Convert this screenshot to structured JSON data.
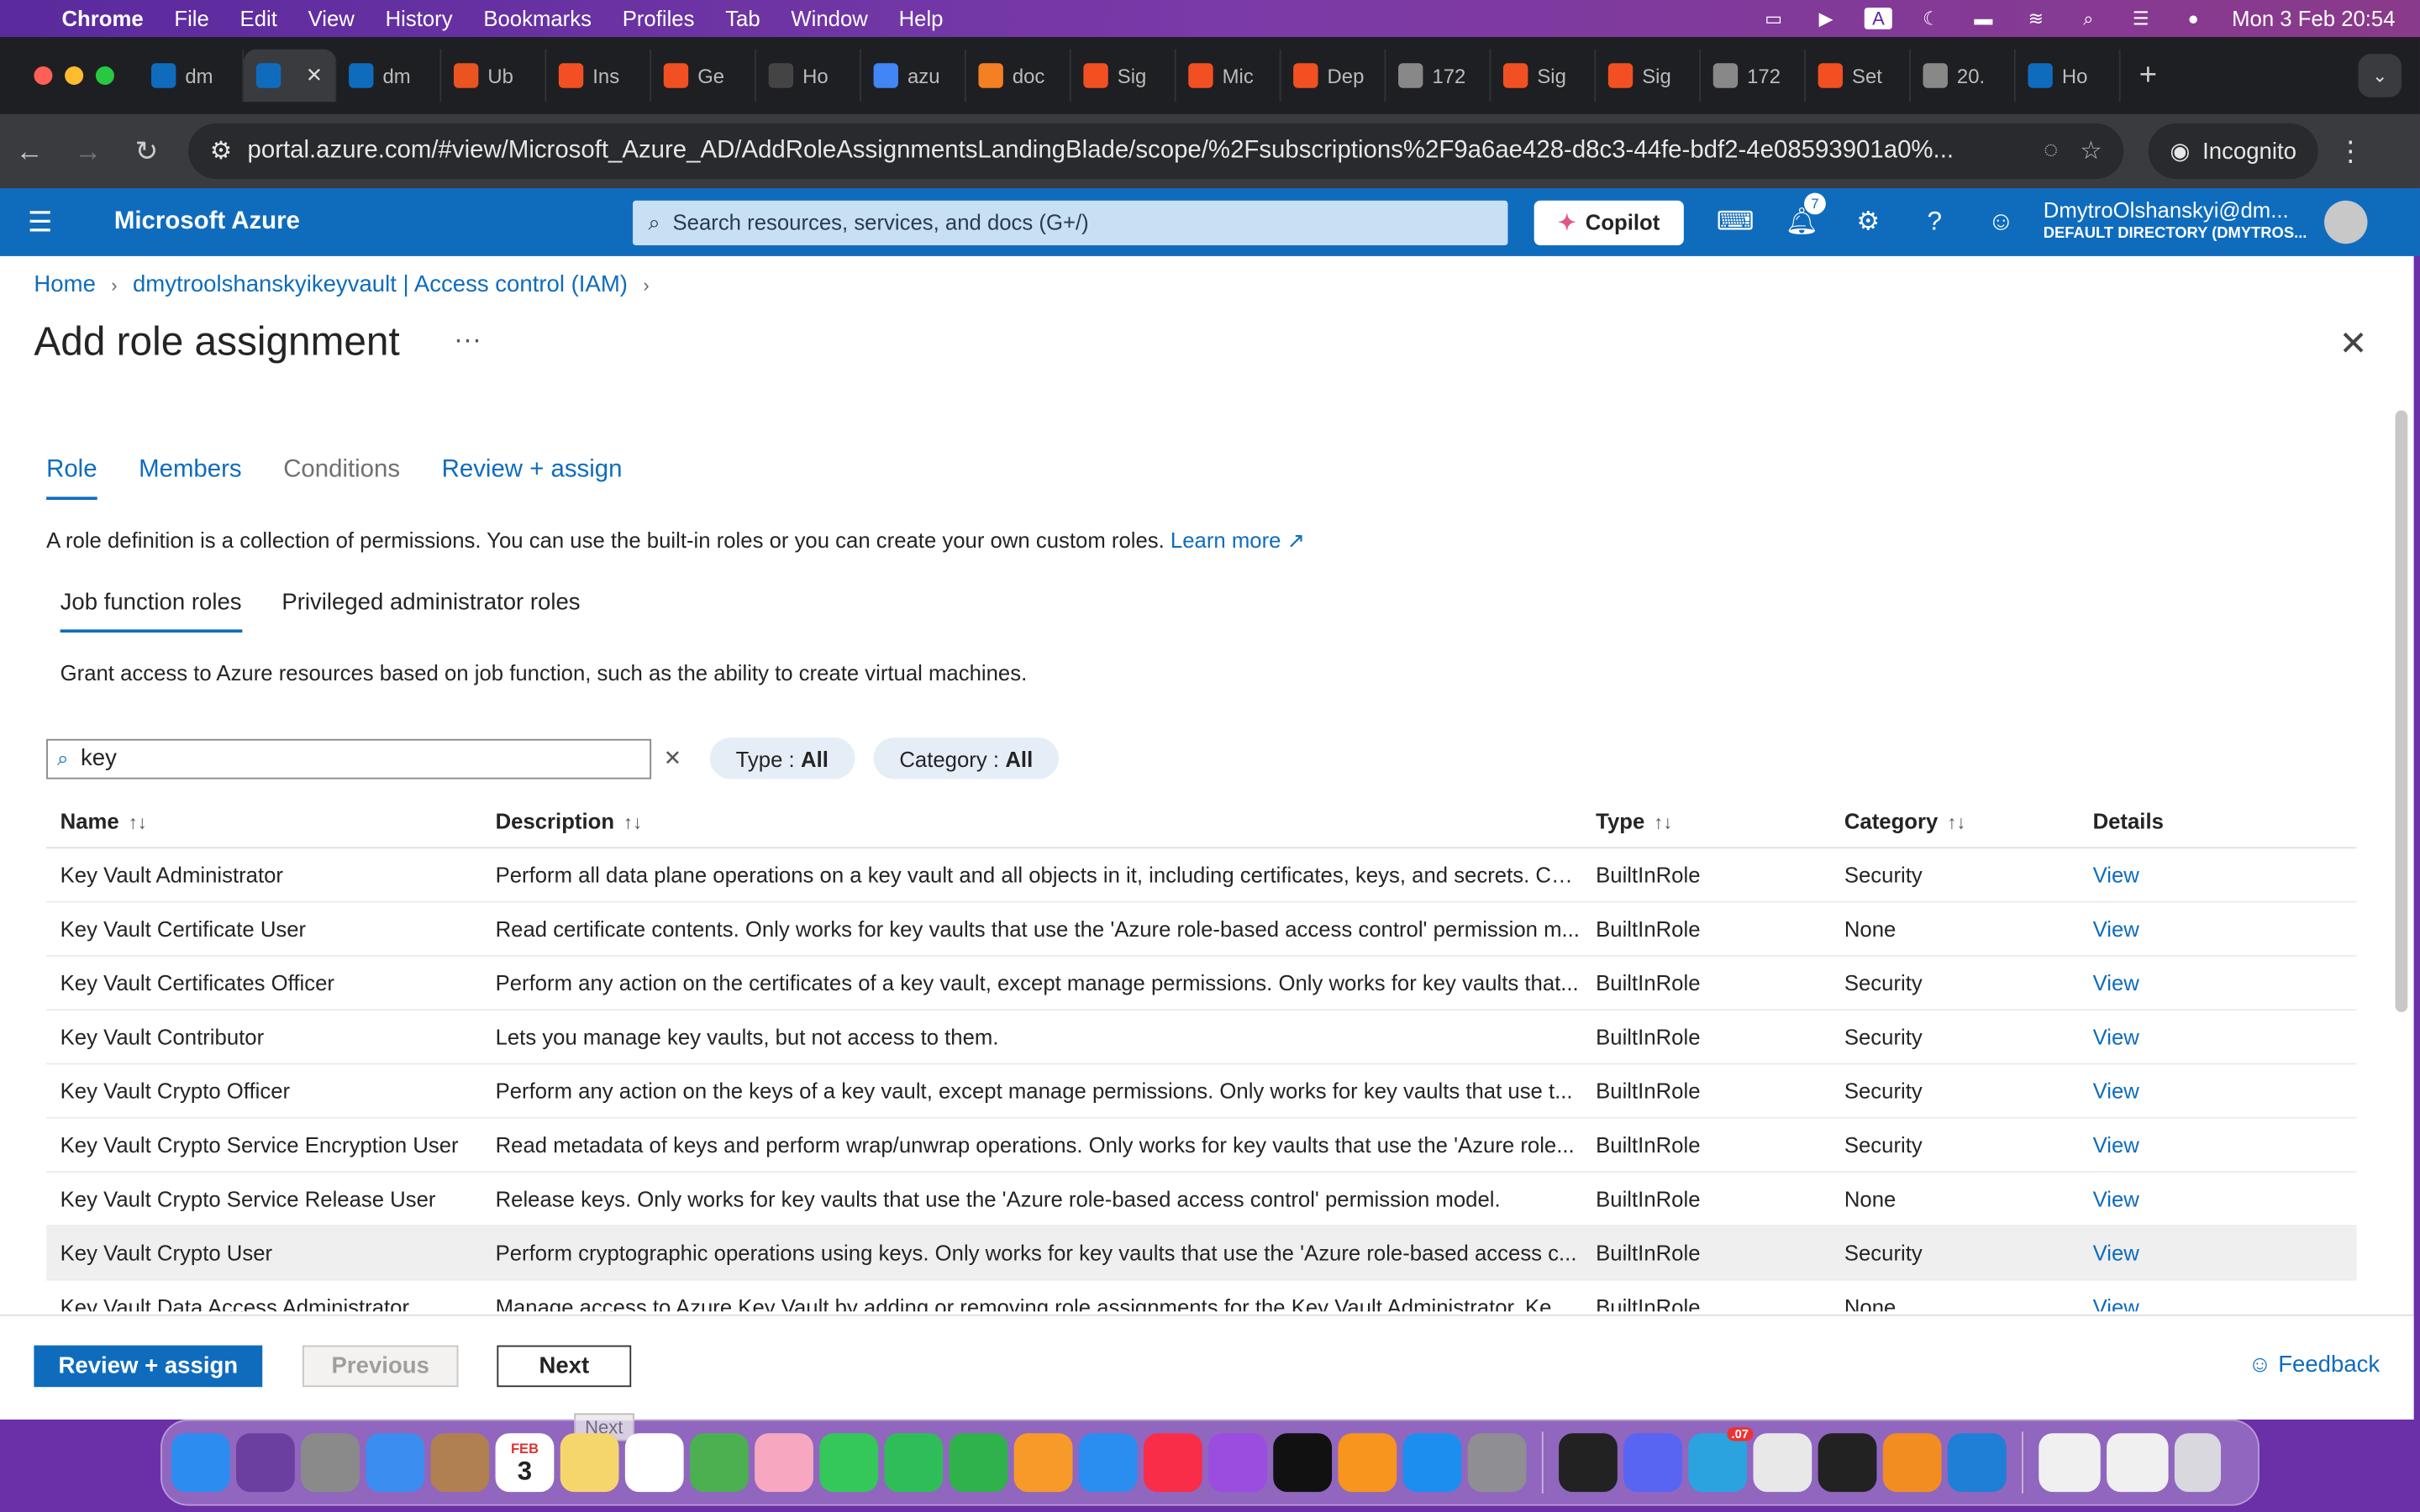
{
  "menubar": {
    "app": "Chrome",
    "items": [
      "File",
      "Edit",
      "View",
      "History",
      "Bookmarks",
      "Profiles",
      "Tab",
      "Window",
      "Help"
    ],
    "clock": "Mon 3 Feb  20:54"
  },
  "tabs": [
    {
      "label": "dm",
      "color": "#0f6cbd"
    },
    {
      "label": "",
      "color": "#0f6cbd",
      "active": true
    },
    {
      "label": "dm",
      "color": "#0f6cbd"
    },
    {
      "label": "Ub",
      "color": "#e95420"
    },
    {
      "label": "Ins",
      "color": "#f25022"
    },
    {
      "label": "Ge",
      "color": "#f25022"
    },
    {
      "label": "Ho",
      "color": "#444"
    },
    {
      "label": "azu",
      "color": "#4285f4"
    },
    {
      "label": "doc",
      "color": "#f48024"
    },
    {
      "label": "Sig",
      "color": "#f25022"
    },
    {
      "label": "Mic",
      "color": "#f25022"
    },
    {
      "label": "Dep",
      "color": "#f25022"
    },
    {
      "label": "172",
      "color": "#888"
    },
    {
      "label": "Sig",
      "color": "#f25022"
    },
    {
      "label": "Sig",
      "color": "#f25022"
    },
    {
      "label": "172",
      "color": "#888"
    },
    {
      "label": "Set",
      "color": "#f25022"
    },
    {
      "label": "20.",
      "color": "#888"
    },
    {
      "label": "Ho",
      "color": "#0f6cbd"
    }
  ],
  "address": {
    "url": "portal.azure.com/#view/Microsoft_Azure_AD/AddRoleAssignmentsLandingBlade/scope/%2Fsubscriptions%2F9a6ae428-d8c3-44fe-bdf2-4e08593901a0%...",
    "incognito": "Incognito"
  },
  "azure": {
    "brand": "Microsoft Azure",
    "search_placeholder": "Search resources, services, and docs (G+/)",
    "copilot": "Copilot",
    "notif_count": "7",
    "account_name": "DmytroOlshanskyi@dm...",
    "account_dir": "DEFAULT DIRECTORY (DMYTROS..."
  },
  "breadcrumb": {
    "home": "Home",
    "resource": "dmytroolshanskyikeyvault | Access control (IAM)"
  },
  "page": {
    "title": "Add role assignment",
    "tabs": [
      "Role",
      "Members",
      "Conditions",
      "Review + assign"
    ],
    "description": "A role definition is a collection of permissions. You can use the built-in roles or you can create your own custom roles.",
    "learn_more": "Learn more",
    "subtabs": [
      "Job function roles",
      "Privileged administrator roles"
    ],
    "grant_text": "Grant access to Azure resources based on job function, such as the ability to create virtual machines.",
    "search_value": "key",
    "type_filter_label": "Type : ",
    "type_filter_value": "All",
    "category_filter_label": "Category : ",
    "category_filter_value": "All"
  },
  "table": {
    "headers": [
      "Name",
      "Description",
      "Type",
      "Category",
      "Details"
    ],
    "rows": [
      [
        "Key Vault Administrator",
        "Perform all data plane operations on a key vault and all objects in it, including certificates, keys, and secrets. Ca...",
        "BuiltInRole",
        "Security",
        "View"
      ],
      [
        "Key Vault Certificate User",
        "Read certificate contents. Only works for key vaults that use the 'Azure role-based access control' permission m...",
        "BuiltInRole",
        "None",
        "View"
      ],
      [
        "Key Vault Certificates Officer",
        "Perform any action on the certificates of a key vault, except manage permissions. Only works for key vaults that...",
        "BuiltInRole",
        "Security",
        "View"
      ],
      [
        "Key Vault Contributor",
        "Lets you manage key vaults, but not access to them.",
        "BuiltInRole",
        "Security",
        "View"
      ],
      [
        "Key Vault Crypto Officer",
        "Perform any action on the keys of a key vault, except manage permissions. Only works for key vaults that use t...",
        "BuiltInRole",
        "Security",
        "View"
      ],
      [
        "Key Vault Crypto Service Encryption User",
        "Read metadata of keys and perform wrap/unwrap operations. Only works for key vaults that use the 'Azure role...",
        "BuiltInRole",
        "Security",
        "View"
      ],
      [
        "Key Vault Crypto Service Release User",
        "Release keys. Only works for key vaults that use the 'Azure role-based access control' permission model.",
        "BuiltInRole",
        "None",
        "View"
      ],
      [
        "Key Vault Crypto User",
        "Perform cryptographic operations using keys. Only works for key vaults that use the 'Azure role-based access c...",
        "BuiltInRole",
        "Security",
        "View"
      ],
      [
        "Key Vault Data Access Administrator",
        "Manage access to Azure Key Vault by adding or removing role assignments for the Key Vault Administrator, Ke...",
        "BuiltInRole",
        "None",
        "View"
      ]
    ]
  },
  "footer": {
    "review_assign": "Review + assign",
    "previous": "Previous",
    "next": "Next",
    "feedback": "Feedback",
    "tooltip": "Next"
  },
  "dock": {
    "apps": [
      {
        "name": "finder",
        "color": "#2d8cf0"
      },
      {
        "name": "siri",
        "color": "#6b3fa0"
      },
      {
        "name": "launchpad",
        "color": "#8a8a8a"
      },
      {
        "name": "mail",
        "color": "#3b8df0"
      },
      {
        "name": "contacts",
        "color": "#b08050"
      },
      {
        "name": "calendar",
        "color": "#ffffff"
      },
      {
        "name": "notes",
        "color": "#f5d66b"
      },
      {
        "name": "reminders",
        "color": "#ffffff"
      },
      {
        "name": "maps",
        "color": "#4caf50"
      },
      {
        "name": "photos",
        "color": "#f7a8c0"
      },
      {
        "name": "messages",
        "color": "#34c759"
      },
      {
        "name": "facetime",
        "color": "#2ebd59"
      },
      {
        "name": "numbers",
        "color": "#2fb24c"
      },
      {
        "name": "pages",
        "color": "#f79a2a"
      },
      {
        "name": "keynote",
        "color": "#2a8df0"
      },
      {
        "name": "music",
        "color": "#fa2d48"
      },
      {
        "name": "podcasts",
        "color": "#9b4de0"
      },
      {
        "name": "tv",
        "color": "#111111"
      },
      {
        "name": "books",
        "color": "#f7951d"
      },
      {
        "name": "appstore",
        "color": "#1c8ef0"
      },
      {
        "name": "settings",
        "color": "#8e8e93"
      },
      {
        "name": "activity-monitor",
        "color": "#222222"
      },
      {
        "name": "discord",
        "color": "#5865f2"
      },
      {
        "name": "telegram",
        "color": "#2aa3df"
      },
      {
        "name": "chrome",
        "color": "#e8e8e8"
      },
      {
        "name": "terminal",
        "color": "#222222"
      },
      {
        "name": "sublime",
        "color": "#f28d22"
      },
      {
        "name": "vscode",
        "color": "#1f7fd6"
      }
    ],
    "cal_month": "FEB",
    "cal_day": "3",
    "telegram_badge": ".07"
  }
}
